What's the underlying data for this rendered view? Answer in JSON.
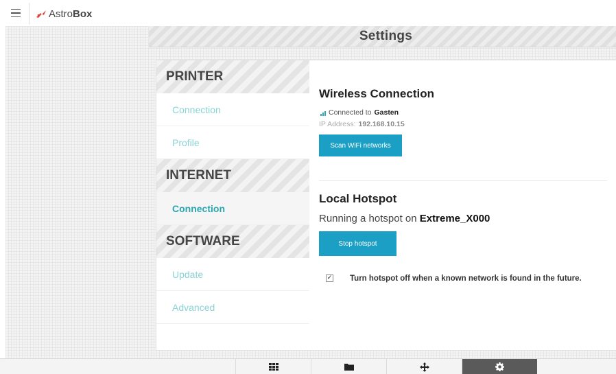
{
  "app": {
    "brand_prefix": "Astro",
    "brand_bold": "Box",
    "page_title": "Settings",
    "accent_color": "#1b9fc4",
    "nav_text_color": "#8ad3d6"
  },
  "nav": {
    "sections": [
      {
        "title": "PRINTER",
        "items": [
          "Connection",
          "Profile"
        ]
      },
      {
        "title": "INTERNET",
        "items": [
          "Connection"
        ]
      },
      {
        "title": "SOFTWARE",
        "items": [
          "Update",
          "Advanced"
        ]
      }
    ],
    "active": "INTERNET / Connection"
  },
  "wireless": {
    "heading": "Wireless Connection",
    "connected_prefix": "Connected to",
    "network_name": "Gasten",
    "ip_label": "IP Address:",
    "ip_value": "192.168.10.15",
    "scan_button": "Scan WiFi networks"
  },
  "hotspot": {
    "heading": "Local Hotspot",
    "running_prefix": "Running a hotspot on",
    "hotspot_name": "Extreme_X000",
    "stop_button": "Stop hotspot",
    "auto_off_checked": true,
    "auto_off_label": "Turn hotspot off when a known network is found in the future."
  },
  "toolbar": {
    "buttons": [
      {
        "icon": "grid-icon",
        "active": false
      },
      {
        "icon": "folder-icon",
        "active": false
      },
      {
        "icon": "move-icon",
        "active": false
      },
      {
        "icon": "gear-icon",
        "active": true
      }
    ]
  }
}
